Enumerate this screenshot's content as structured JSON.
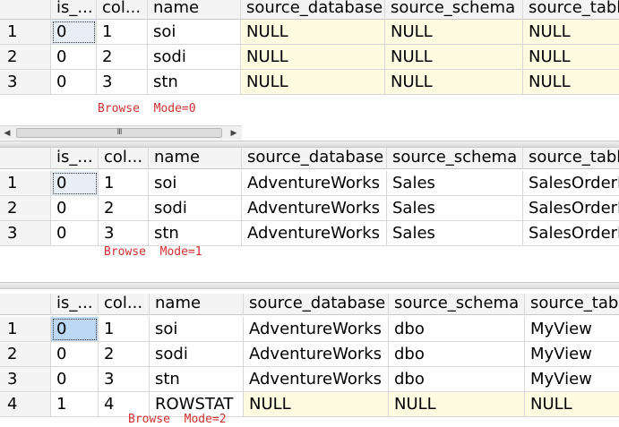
{
  "columns": [
    "is_...",
    "col...",
    "name",
    "source_database",
    "source_schema",
    "source_table"
  ],
  "panes": [
    {
      "mode_label": "Browse  Mode=0",
      "rows": [
        {
          "rownum": "1",
          "is_hidden": "0",
          "column_ordinal": "1",
          "name": "soi",
          "source_database": "NULL",
          "source_schema": "NULL",
          "source_table": "NULL"
        },
        {
          "rownum": "2",
          "is_hidden": "0",
          "column_ordinal": "2",
          "name": "sodi",
          "source_database": "NULL",
          "source_schema": "NULL",
          "source_table": "NULL"
        },
        {
          "rownum": "3",
          "is_hidden": "0",
          "column_ordinal": "3",
          "name": "stn",
          "source_database": "NULL",
          "source_schema": "NULL",
          "source_table": "NULL"
        }
      ]
    },
    {
      "mode_label": "Browse  Mode=1",
      "rows": [
        {
          "rownum": "1",
          "is_hidden": "0",
          "column_ordinal": "1",
          "name": "soi",
          "source_database": "AdventureWorks",
          "source_schema": "Sales",
          "source_table": "SalesOrderD"
        },
        {
          "rownum": "2",
          "is_hidden": "0",
          "column_ordinal": "2",
          "name": "sodi",
          "source_database": "AdventureWorks",
          "source_schema": "Sales",
          "source_table": "SalesOrderD"
        },
        {
          "rownum": "3",
          "is_hidden": "0",
          "column_ordinal": "3",
          "name": "stn",
          "source_database": "AdventureWorks",
          "source_schema": "Sales",
          "source_table": "SalesOrderD"
        }
      ]
    },
    {
      "mode_label": "Browse  Mode=2",
      "rows": [
        {
          "rownum": "1",
          "is_hidden": "0",
          "column_ordinal": "1",
          "name": "soi",
          "source_database": "AdventureWorks",
          "source_schema": "dbo",
          "source_table": "MyView"
        },
        {
          "rownum": "2",
          "is_hidden": "0",
          "column_ordinal": "2",
          "name": "sodi",
          "source_database": "AdventureWorks",
          "source_schema": "dbo",
          "source_table": "MyView"
        },
        {
          "rownum": "3",
          "is_hidden": "0",
          "column_ordinal": "3",
          "name": "stn",
          "source_database": "AdventureWorks",
          "source_schema": "dbo",
          "source_table": "MyView"
        },
        {
          "rownum": "4",
          "is_hidden": "1",
          "column_ordinal": "4",
          "name": "ROWSTAT",
          "source_database": "NULL",
          "source_schema": "NULL",
          "source_table": "NULL"
        }
      ]
    }
  ],
  "scrollbar": {
    "grip": "III",
    "left_arrow": "◀",
    "right_arrow": "▶"
  },
  "colors": {
    "null_cell_bg": "#fdfbe0",
    "mode_label": "#d03030",
    "selected_cell_bg": "#bcd8f5"
  }
}
